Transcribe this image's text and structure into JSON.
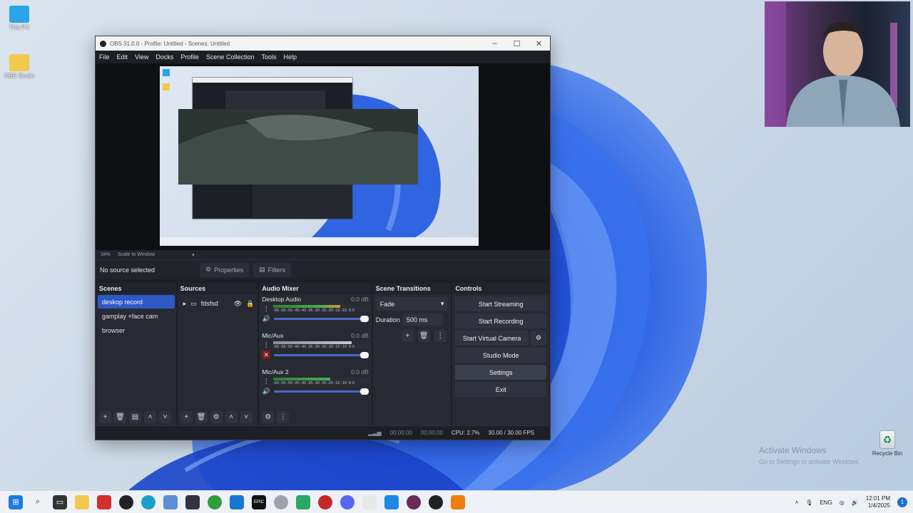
{
  "desktop": {
    "icons": [
      {
        "label": "This PC",
        "icon": "monitor-icon",
        "color": "#29a5e8"
      },
      {
        "label": "OBS Studio",
        "icon": "folder-icon",
        "color": "#f2c94c"
      }
    ],
    "recycle_bin_label": "Recycle Bin",
    "watermark_title": "Activate Windows",
    "watermark_sub": "Go to Settings to activate Windows."
  },
  "obs": {
    "window_title": "OBS 31.0.0 - Profile: Untitled - Scenes: Untitled",
    "menu": [
      "File",
      "Edit",
      "View",
      "Docks",
      "Profile",
      "Scene Collection",
      "Tools",
      "Help"
    ],
    "zoom": "34%",
    "zoom_mode": "Scale to Window",
    "no_source": "No source selected",
    "properties_label": "Properties",
    "filters_label": "Filters",
    "scenes": {
      "header": "Scenes",
      "items": [
        "deskop record",
        "gamplay +face cam",
        "browser"
      ],
      "active_index": 0
    },
    "sources": {
      "header": "Sources",
      "items": [
        {
          "name": "fdsfsd"
        }
      ]
    },
    "mixer": {
      "header": "Audio Mixer",
      "scale": "-60 -55 -50 -45 -40 -35 -30 -25 -20 -15 -10 -5 0",
      "channels": [
        {
          "name": "Desktop Audio",
          "db": "0.0 dB",
          "muted": false
        },
        {
          "name": "Mic/Aux",
          "db": "0.0 dB",
          "muted": true
        },
        {
          "name": "Mic/Aux 2",
          "db": "0.0 dB",
          "muted": false
        }
      ]
    },
    "transitions": {
      "header": "Scene Transitions",
      "selected": "Fade",
      "duration_label": "Duration",
      "duration_value": "500 ms"
    },
    "controls": {
      "header": "Controls",
      "start_streaming": "Start Streaming",
      "start_recording": "Start Recording",
      "start_virtual_camera": "Start Virtual Camera",
      "studio_mode": "Studio Mode",
      "settings": "Settings",
      "exit": "Exit"
    },
    "status": {
      "stream_time": "00:00:00",
      "record_time": "00:00:00",
      "cpu": "CPU: 2.7%",
      "fps": "30.00 / 30.00 FPS"
    }
  },
  "taskbar": {
    "language": "ENG",
    "time": "12:01 PM",
    "date": "1/4/2025",
    "notifications": "1"
  }
}
